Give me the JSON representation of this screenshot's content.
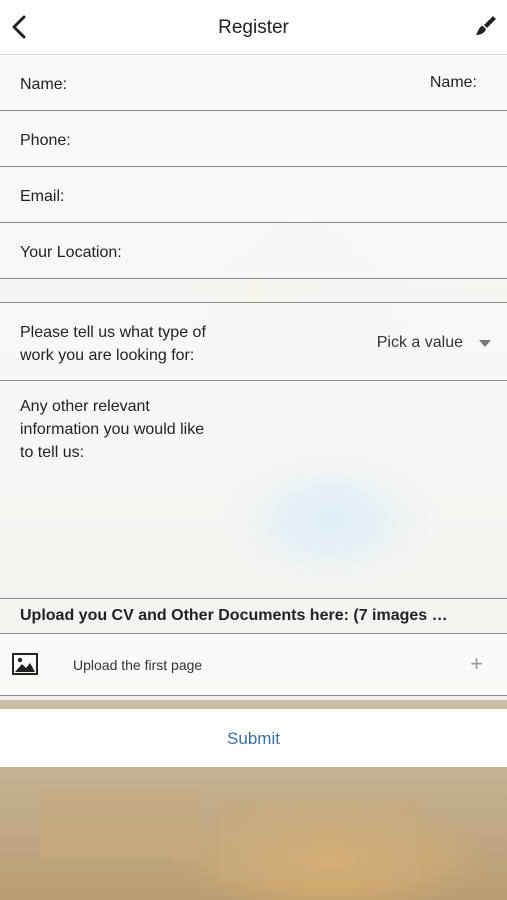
{
  "header": {
    "title": "Register",
    "back_icon": "chevron-left-icon",
    "right_icon": "paintbrush-icon"
  },
  "form": {
    "name_label": "Name:",
    "name_value": "Name:",
    "phone_label": "Phone:",
    "email_label": "Email:",
    "location_label": "Your Location:",
    "work_type_label_line1": "Please tell us what type of",
    "work_type_label_line2": "work you are looking for:",
    "work_type_value": "Pick a value",
    "other_info_line1": "Any other relevant",
    "other_info_line2": "information you would like",
    "other_info_line3": "to tell us:"
  },
  "upload": {
    "heading": "Upload you CV and Other Documents here: (7 images …",
    "row_icon": "image-icon",
    "row_label": "Upload the first page",
    "add_symbol": "+"
  },
  "submit": {
    "label": "Submit"
  },
  "colors": {
    "accent": "#3a6ea5",
    "divider": "#8a8a8a"
  }
}
